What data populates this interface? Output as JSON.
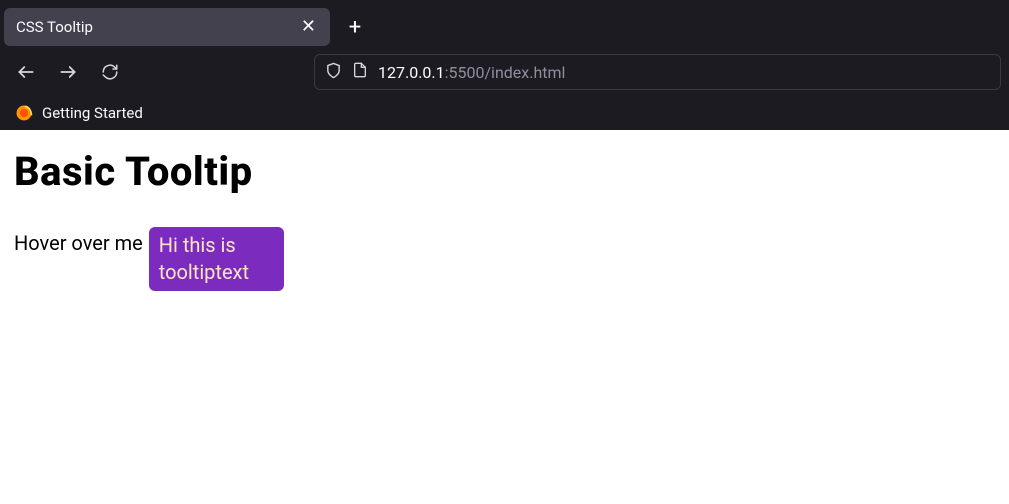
{
  "tab": {
    "title": "CSS Tooltip"
  },
  "url": {
    "host_prefix": "127.0.0.1",
    "host_suffix": ":5500/index.html"
  },
  "bookmarks": {
    "getting_started": "Getting Started"
  },
  "page": {
    "heading": "Basic Tooltip",
    "hover_text": "Hover over me",
    "tooltip_text": "Hi this is tooltiptext"
  }
}
